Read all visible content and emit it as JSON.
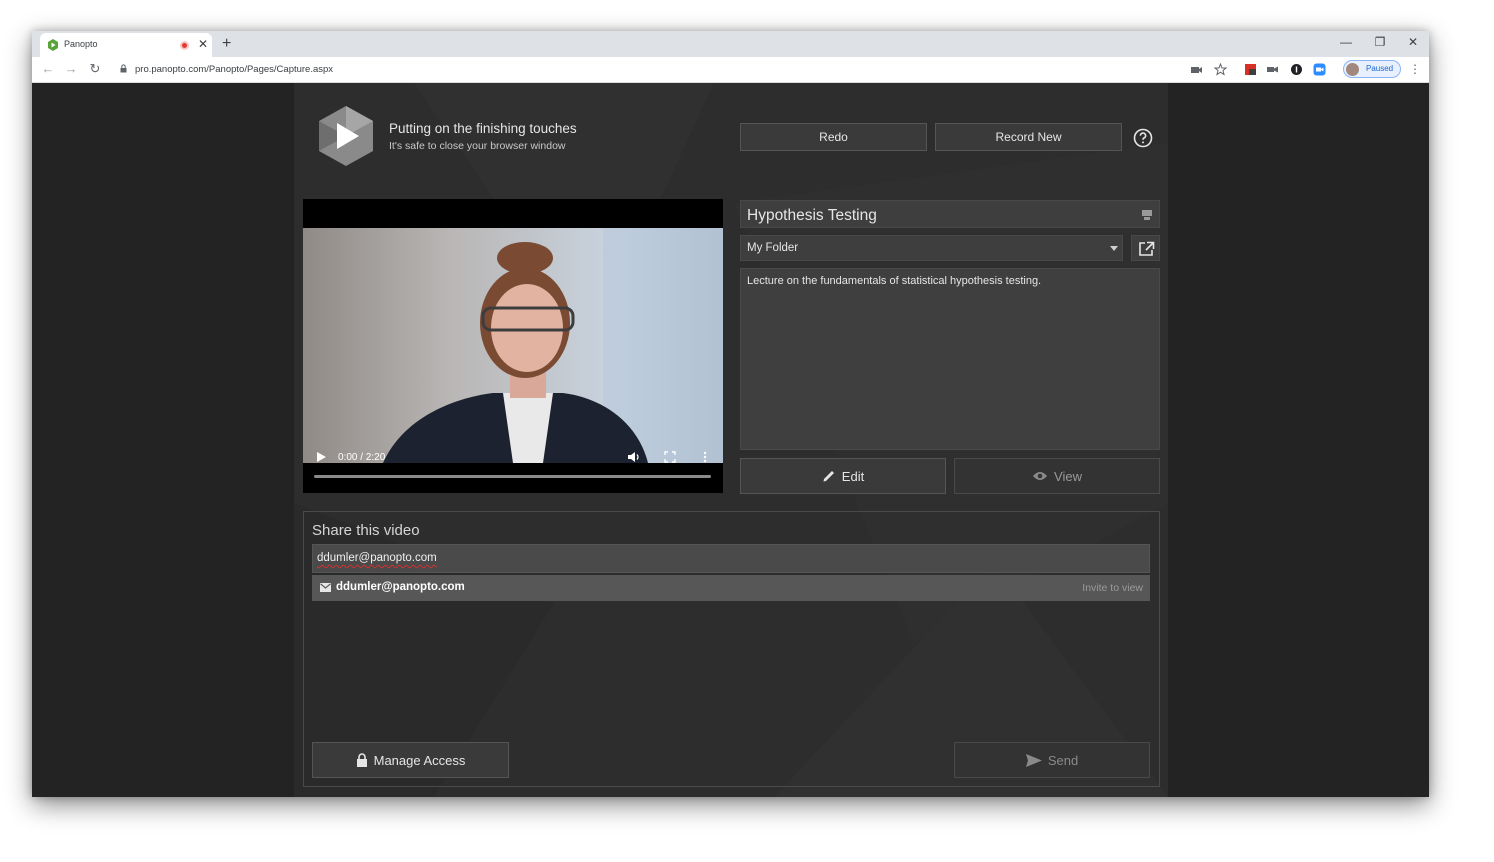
{
  "browser": {
    "tab_title": "Panopto",
    "tab_close": "✕",
    "new_tab": "+",
    "url": "pro.panopto.com/Panopto/Pages/Capture.aspx",
    "profile_label": "Paused",
    "window_controls": {
      "minimize": "—",
      "restore": "❐",
      "close": "✕"
    },
    "nav": {
      "back": "←",
      "forward": "→",
      "reload": "↻"
    },
    "menu": "⋮"
  },
  "header": {
    "status_title": "Putting on the finishing touches",
    "status_subtitle": "It's safe to close your browser window",
    "redo_label": "Redo",
    "record_new_label": "Record New"
  },
  "video": {
    "time": "0:00 / 2:20",
    "progress": 0
  },
  "details": {
    "title": "Hypothesis Testing",
    "folder": "My Folder",
    "description": "Lecture on the fundamentals of statistical hypothesis testing.",
    "edit_label": "Edit",
    "view_label": "View"
  },
  "share": {
    "title": "Share this video",
    "input_value": "ddumler@panopto.com",
    "suggestion_email": "ddumler@panopto.com",
    "suggestion_hint": "Invite to view",
    "manage_label": "Manage Access",
    "send_label": "Send"
  },
  "colors": {
    "page_bg": "#232323",
    "panel_bg": "#2d2d2d",
    "button_bg": "#3a3a3a",
    "record_dot": "#e53935",
    "profile_accent": "#1967d2"
  }
}
